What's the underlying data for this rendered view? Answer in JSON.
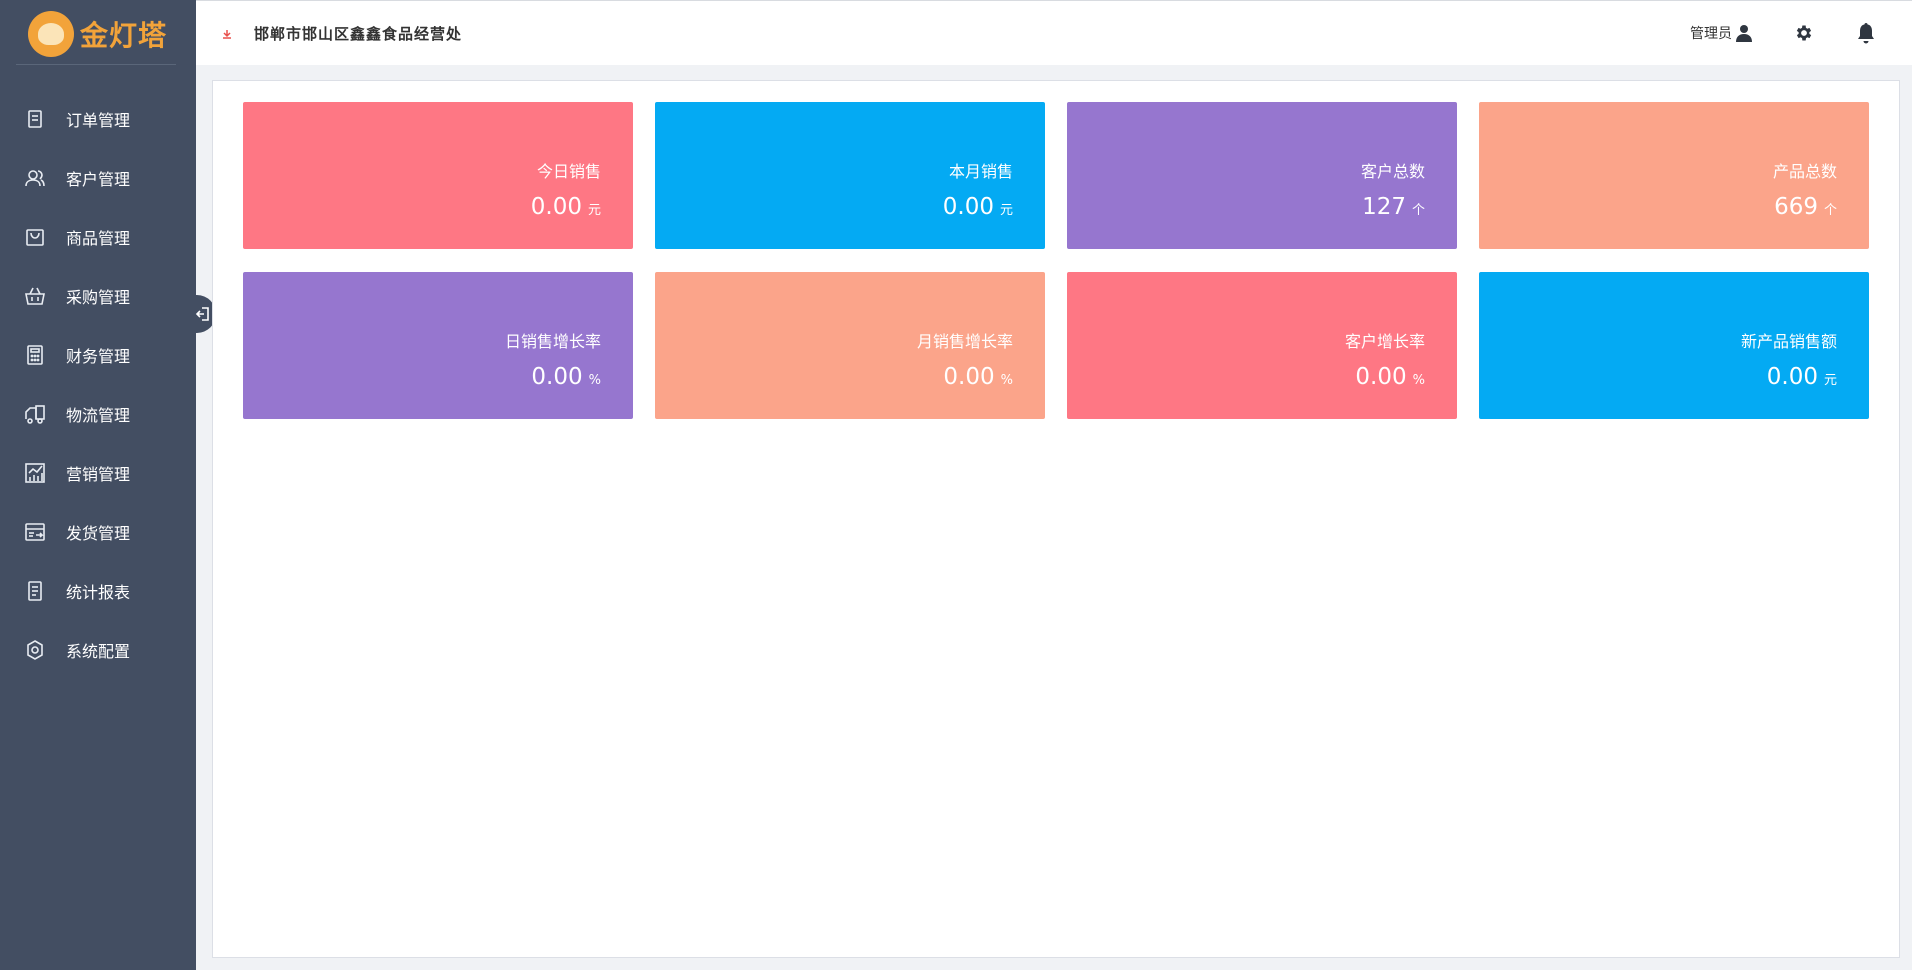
{
  "app": {
    "logo_text": "金灯塔",
    "company_name": "邯郸市邯山区鑫鑫食品经营处",
    "admin_label": "管理员"
  },
  "sidebar": {
    "items": [
      {
        "label": "订单管理",
        "icon": "order-icon"
      },
      {
        "label": "客户管理",
        "icon": "users-icon"
      },
      {
        "label": "商品管理",
        "icon": "bag-icon"
      },
      {
        "label": "采购管理",
        "icon": "basket-icon"
      },
      {
        "label": "财务管理",
        "icon": "calculator-icon"
      },
      {
        "label": "物流管理",
        "icon": "truck-icon"
      },
      {
        "label": "营销管理",
        "icon": "chart-icon"
      },
      {
        "label": "发货管理",
        "icon": "delivery-icon"
      },
      {
        "label": "统计报表",
        "icon": "report-icon"
      },
      {
        "label": "系统配置",
        "icon": "settings-icon"
      }
    ]
  },
  "stats": [
    {
      "title": "今日销售",
      "value": "0.00",
      "unit": "元",
      "color": "#fe7784"
    },
    {
      "title": "本月销售",
      "value": "0.00",
      "unit": "元",
      "color": "#04aaf3"
    },
    {
      "title": "客户总数",
      "value": "127",
      "unit": "个",
      "color": "#9676cf"
    },
    {
      "title": "产品总数",
      "value": "669",
      "unit": "个",
      "color": "#fba48a"
    },
    {
      "title": "日销售增长率",
      "value": "0.00",
      "unit": "%",
      "color": "#9676cf"
    },
    {
      "title": "月销售增长率",
      "value": "0.00",
      "unit": "%",
      "color": "#fba48a"
    },
    {
      "title": "客户增长率",
      "value": "0.00",
      "unit": "%",
      "color": "#fe7784"
    },
    {
      "title": "新产品销售额",
      "value": "0.00",
      "unit": "元",
      "color": "#04aaf3"
    }
  ],
  "colors": {
    "sidebar_bg": "#434e62",
    "brand": "#f2a33a"
  }
}
